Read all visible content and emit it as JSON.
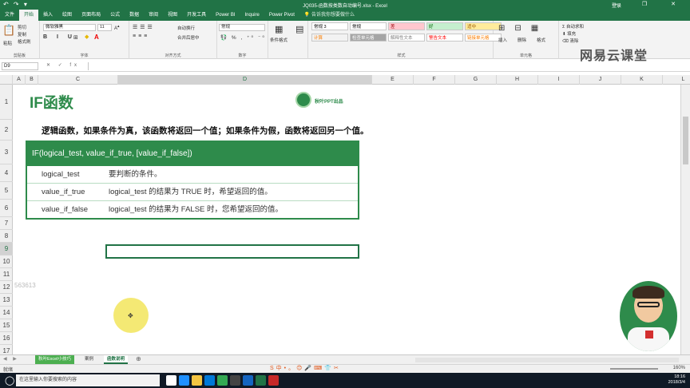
{
  "window": {
    "title": "JQ035-函数按类数自动编号.xlsx - Excel",
    "user": "登录",
    "quick_access": "↶ ↷ ▾",
    "win_buttons": "— ❐ ✕"
  },
  "tabs": [
    {
      "label": "文件",
      "active": false
    },
    {
      "label": "开始",
      "active": true
    },
    {
      "label": "插入",
      "active": false
    },
    {
      "label": "绘图",
      "active": false
    },
    {
      "label": "页面布局",
      "active": false
    },
    {
      "label": "公式",
      "active": false
    },
    {
      "label": "数据",
      "active": false
    },
    {
      "label": "审阅",
      "active": false
    },
    {
      "label": "视图",
      "active": false
    },
    {
      "label": "开发工具",
      "active": false
    },
    {
      "label": "Power BI",
      "active": false
    },
    {
      "label": "Inquire",
      "active": false
    },
    {
      "label": "Power Pivot",
      "active": false
    }
  ],
  "tell_me": "告诉我你想要做什么",
  "ribbon": {
    "clipboard": {
      "label": "剪贴板",
      "paste": "粘贴",
      "cut": "剪切",
      "copy": "复制",
      "format_painter": "格式刷"
    },
    "font": {
      "label": "字体",
      "name": "微软雅黑",
      "size": "11"
    },
    "alignment": {
      "label": "对齐方式",
      "wrap": "自动换行",
      "merge": "合并后居中"
    },
    "number": {
      "label": "数字",
      "format": "常规"
    },
    "cond_format": "条件格式",
    "table_format": "套用表格格式",
    "styles": {
      "label": "样式",
      "items": [
        {
          "name": "常规 3",
          "bg": "#ffffff",
          "fg": "#000000"
        },
        {
          "name": "常规",
          "bg": "#ffffff",
          "fg": "#000000"
        },
        {
          "name": "差",
          "bg": "#ffc7ce",
          "fg": "#9c0006"
        },
        {
          "name": "好",
          "bg": "#c6efce",
          "fg": "#006100"
        },
        {
          "name": "适中",
          "bg": "#ffeb9c",
          "fg": "#9c5700"
        },
        {
          "name": "计算",
          "bg": "#f2f2f2",
          "fg": "#fa7d00"
        },
        {
          "name": "检查单元格",
          "bg": "#a5a5a5",
          "fg": "#ffffff"
        },
        {
          "name": "解释性文本",
          "bg": "#ffffff",
          "fg": "#7f7f7f"
        },
        {
          "name": "警告文本",
          "bg": "#ffffff",
          "fg": "#ff0000"
        },
        {
          "name": "链接单元格",
          "bg": "#ffffff",
          "fg": "#fa7d00"
        }
      ]
    },
    "cells": {
      "label": "单元格",
      "insert": "插入",
      "delete": "删除",
      "format": "格式"
    },
    "editing": {
      "label": "编辑",
      "autosum": "自动求和",
      "fill": "填充",
      "clear": "清除"
    },
    "brand": "网易云课堂"
  },
  "formula_bar": {
    "name_box": "D9",
    "fx_icons": "✕ ✓ fx",
    "content": ""
  },
  "columns": [
    {
      "label": "A",
      "selected": false
    },
    {
      "label": "B",
      "selected": false
    },
    {
      "label": "C",
      "selected": false
    },
    {
      "label": "D",
      "selected": true
    },
    {
      "label": "E",
      "selected": false
    },
    {
      "label": "F",
      "selected": false
    },
    {
      "label": "G",
      "selected": false
    },
    {
      "label": "H",
      "selected": false
    },
    {
      "label": "I",
      "selected": false
    },
    {
      "label": "J",
      "selected": false
    },
    {
      "label": "K",
      "selected": false
    },
    {
      "label": "L",
      "selected": false
    }
  ],
  "rows": [
    "1",
    "2",
    "3",
    "4",
    "5",
    "6",
    "7",
    "8",
    "9",
    "10",
    "11",
    "12",
    "13",
    "14",
    "15",
    "16",
    "17"
  ],
  "selected_row": "9",
  "content": {
    "heading": "IF函数",
    "badge": "秋叶PPT出品",
    "description": "逻辑函数，如果条件为真，该函数将返回一个值；如果条件为假，函数将返回另一个值。",
    "syntax": "IF(logical_test, value_if_true, [value_if_false])",
    "params": [
      {
        "name": "logical_test",
        "desc": "要判断的条件。"
      },
      {
        "name": "value_if_true",
        "desc": "logical_test 的结果为 TRUE 时，希望返回的值。"
      },
      {
        "name": "value_if_false",
        "desc": "logical_test 的结果为 FALSE 时，您希望返回的值。"
      }
    ],
    "watermark": "563613"
  },
  "sheets": {
    "tabs": [
      {
        "label": "秋叶Excel小技巧",
        "style": "green"
      },
      {
        "label": "案例",
        "style": "normal"
      },
      {
        "label": "函数说明",
        "style": "active"
      }
    ],
    "nav": "◀ ▶",
    "add": "⊕"
  },
  "status": {
    "ready": "就绪",
    "zoom": "160%"
  },
  "ime": "S中•。😊🎤⌨👕✂",
  "taskbar": {
    "search_placeholder": "在这里输入你要搜索的内容",
    "time": "18:16",
    "date": "2018/3/4",
    "icons": [
      {
        "name": "task-view-icon",
        "color": "#ffffff"
      },
      {
        "name": "edge-icon",
        "color": "#1e90ff"
      },
      {
        "name": "explorer-icon",
        "color": "#f4c542"
      },
      {
        "name": "store-icon",
        "color": "#0078d7"
      },
      {
        "name": "chrome-icon",
        "color": "#34a853"
      },
      {
        "name": "app-icon",
        "color": "#444"
      },
      {
        "name": "app2-icon",
        "color": "#1565c0"
      },
      {
        "name": "excel-taskbar-icon",
        "color": "#217346"
      },
      {
        "name": "app3-icon",
        "color": "#c62828"
      }
    ]
  }
}
